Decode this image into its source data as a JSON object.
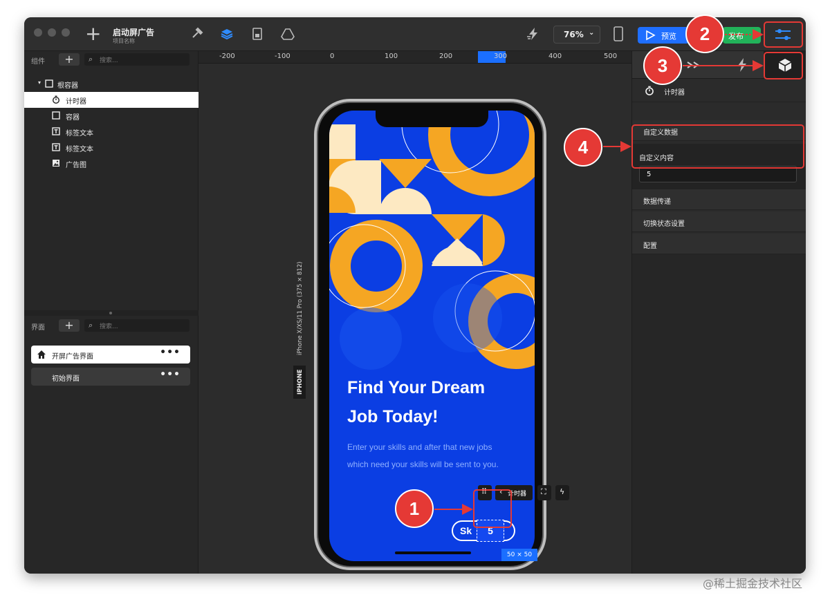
{
  "titlebar": {
    "project_title": "启动屏广告",
    "project_subtitle": "项目名称",
    "zoom": "76%",
    "preview_label": "预览",
    "publish_label": "发布"
  },
  "components_panel": {
    "title": "组件",
    "search_placeholder": "搜索...",
    "tree": [
      {
        "label": "根容器",
        "icon": "container-icon"
      },
      {
        "label": "计时器",
        "icon": "timer-icon"
      },
      {
        "label": "容器",
        "icon": "container-icon"
      },
      {
        "label": "标签文本",
        "icon": "text-icon"
      },
      {
        "label": "标签文本",
        "icon": "text-icon"
      },
      {
        "label": "广告图",
        "icon": "image-icon"
      }
    ]
  },
  "pages_panel": {
    "title": "界面",
    "search_placeholder": "搜索...",
    "pages": [
      {
        "label": "开屏广告界面",
        "more": "•••"
      },
      {
        "label": "初始界面",
        "more": "•••"
      }
    ]
  },
  "canvas": {
    "ruler_ticks": [
      "-200",
      "-100",
      "0",
      "100",
      "200",
      "300",
      "400",
      "500"
    ],
    "device_label": "iPhone X/XS/11 Pro (375 × 812)",
    "device_tag": "IPHONE",
    "size_tag": "50 × 50",
    "toolbar_component": "计时器"
  },
  "screen": {
    "headline_1": "Find Your Dream",
    "headline_2": "Job Today!",
    "sub_1": "Enter your skills and after that new jobs",
    "sub_2": "which need your skills will be sent to you.",
    "skip_label": "Sk",
    "timer_value": "5"
  },
  "inspector": {
    "component_name": "计时器",
    "sections": [
      "自定义数据",
      "数据传递",
      "切换状态设置",
      "配置"
    ],
    "custom_content_label": "自定义内容",
    "custom_content_value": "5"
  },
  "annotations": [
    "1",
    "2",
    "3",
    "4"
  ],
  "watermark": "@稀土掘金技术社区",
  "colors": {
    "accent_blue": "#1b6fff",
    "publish_green": "#22b35a",
    "annotation_red": "#e53935",
    "screen_blue": "#0b3ee3",
    "shape_yellow": "#f5a623",
    "shape_cream": "#fde9c2"
  }
}
